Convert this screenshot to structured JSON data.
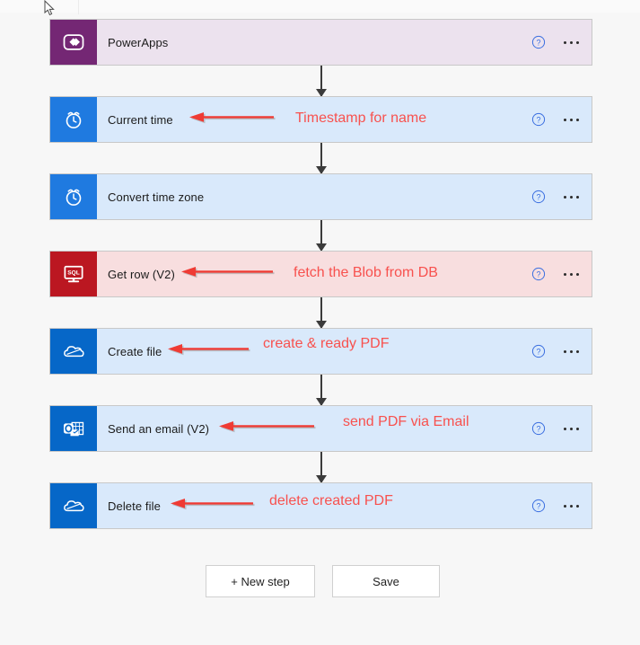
{
  "app": {
    "title": "Power Automate flow designer",
    "background_color": "#f7f7f7"
  },
  "colors": {
    "powerapps_purple": "#742774",
    "connector_blue": "#1f7ae0",
    "outlook_blue": "#0667c8",
    "sql_red": "#bb1721",
    "card_blue_bg": "#d9e9fb",
    "card_purple_bg": "#ece2ee",
    "card_red_bg": "#f8dedf",
    "annotation_red": "#f8514e",
    "arrow_gray": "#3b3b3b",
    "help_icon_blue": "#3b6fe0"
  },
  "flow": {
    "steps": [
      {
        "title": "PowerApps",
        "icon": "powerapps-icon",
        "theme": "powerapps",
        "annotation": "",
        "has_annotation_arrow": false,
        "help_label": "?",
        "menu_label": "..."
      },
      {
        "title": "Current time",
        "icon": "alarm-clock-icon",
        "theme": "blue",
        "annotation": "Timestamp for name",
        "has_annotation_arrow": true,
        "help_label": "?",
        "menu_label": "..."
      },
      {
        "title": "Convert time zone",
        "icon": "alarm-clock-icon",
        "theme": "blue",
        "annotation": "",
        "has_annotation_arrow": false,
        "help_label": "?",
        "menu_label": "..."
      },
      {
        "title": "Get row (V2)",
        "icon": "sql-server-icon",
        "theme": "red",
        "annotation": "fetch the Blob from DB",
        "has_annotation_arrow": true,
        "help_label": "?",
        "menu_label": "..."
      },
      {
        "title": "Create file",
        "icon": "onedrive-icon",
        "theme": "blue-dk",
        "annotation": "create & ready PDF",
        "has_annotation_arrow": true,
        "help_label": "?",
        "menu_label": "..."
      },
      {
        "title": "Send an email (V2)",
        "icon": "outlook-icon",
        "theme": "blue-dk",
        "annotation": "send PDF via Email",
        "has_annotation_arrow": true,
        "help_label": "?",
        "menu_label": "..."
      },
      {
        "title": "Delete file",
        "icon": "onedrive-icon",
        "theme": "blue-dk",
        "annotation": "delete created PDF",
        "has_annotation_arrow": true,
        "help_label": "?",
        "menu_label": "..."
      }
    ]
  },
  "footer": {
    "new_step_label": "+ New step",
    "save_label": "Save"
  }
}
